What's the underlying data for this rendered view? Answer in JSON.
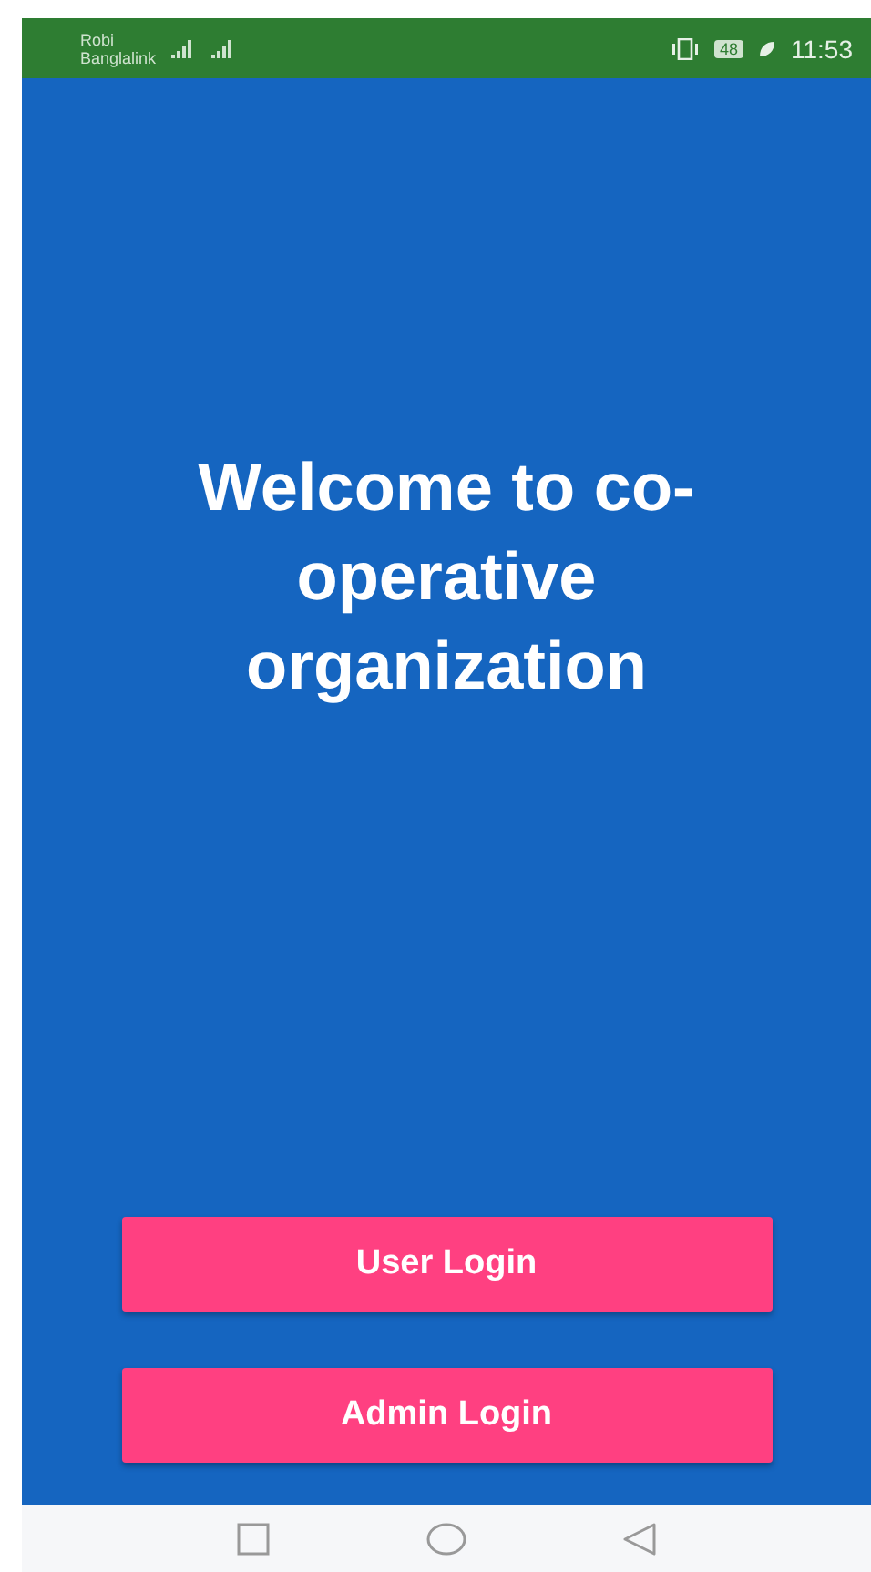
{
  "status_bar": {
    "carrier_1": "Robi",
    "carrier_2": "Banglalink",
    "battery": "48",
    "time": "11:53"
  },
  "welcome": {
    "title": "Welcome to co-operative organization"
  },
  "buttons": [
    {
      "label": "User Login"
    },
    {
      "label": "Admin Login"
    }
  ]
}
